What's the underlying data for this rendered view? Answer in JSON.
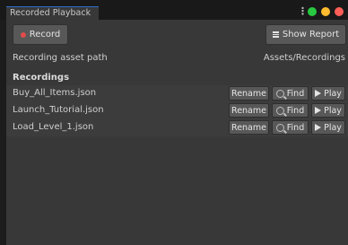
{
  "window": {
    "tab_title": "Recorded Playback"
  },
  "toolbar": {
    "record_label": "Record",
    "show_report_label": "Show Report"
  },
  "asset_path": {
    "label": "Recording asset path",
    "value": "Assets/Recordings"
  },
  "recordings": {
    "header": "Recordings",
    "rename_label": "Rename",
    "find_label": "Find",
    "play_label": "Play",
    "items": [
      {
        "name": "Buy_All_Items.json"
      },
      {
        "name": "Launch_Tutorial.json"
      },
      {
        "name": "Load_Level_1.json"
      }
    ]
  },
  "colors": {
    "accent": "#2c6fc7",
    "record_dot": "#e24a4a",
    "traffic_green": "#28c840",
    "traffic_yellow": "#febc2e",
    "traffic_red": "#ff5f57"
  },
  "icons": [
    "kebab-menu-icon",
    "record-dot-icon",
    "menu-lines-icon",
    "magnifier-icon",
    "play-triangle-icon"
  ]
}
